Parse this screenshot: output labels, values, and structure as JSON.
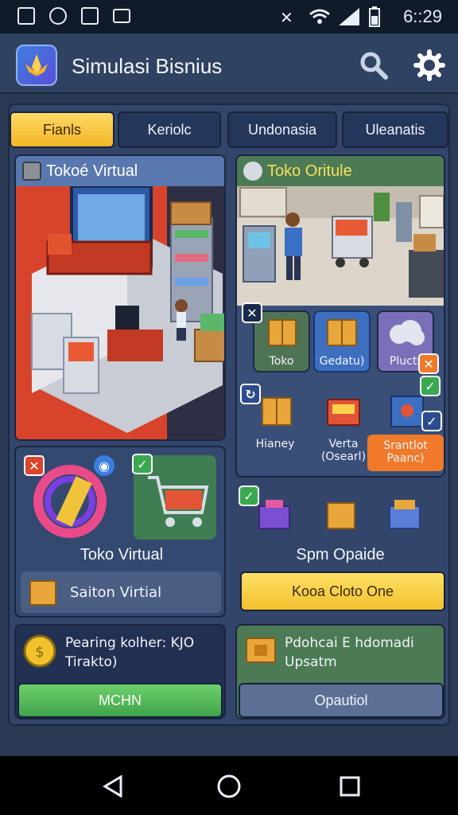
{
  "status": {
    "time": "6::29"
  },
  "app": {
    "title": "Simulasi Bisnius"
  },
  "tabs": [
    {
      "label": "Fianls",
      "active": true
    },
    {
      "label": "Keriolc",
      "active": false
    },
    {
      "label": "Undonasia",
      "active": false
    },
    {
      "label": "Uleanatis",
      "active": false
    }
  ],
  "left_panel": {
    "title": "Tokoé Virtual",
    "card_title": "Toko Virtual",
    "row_label": "Saiton Virtial"
  },
  "right_panel": {
    "title": "Toko Oritule",
    "tiles_top": [
      "Toko",
      "Gedatu)",
      "Pluctr"
    ],
    "tiles_mid": [
      "Hianey",
      "Verta\n(Osearl)",
      "Srantlot\nPaanc)"
    ],
    "sub_label": "Spm Opaide",
    "yellow_button": "Kooa Cloto One"
  },
  "bottom_left": {
    "text": "Pearing kolher: KJO\nTirakto)",
    "button": "MCHN"
  },
  "bottom_right": {
    "text": "Pdohcai E hdomadi\nUpsatm",
    "button": "Opautiol"
  },
  "colors": {
    "accent_yellow": "#f2c12e",
    "green": "#4cb050",
    "panel_blue": "#3d5a8c",
    "background": "#2a3a55"
  },
  "icons": [
    "wifi-icon",
    "signal-icon",
    "battery-icon",
    "search-icon",
    "gear-icon",
    "back-icon",
    "home-icon",
    "recents-icon"
  ]
}
